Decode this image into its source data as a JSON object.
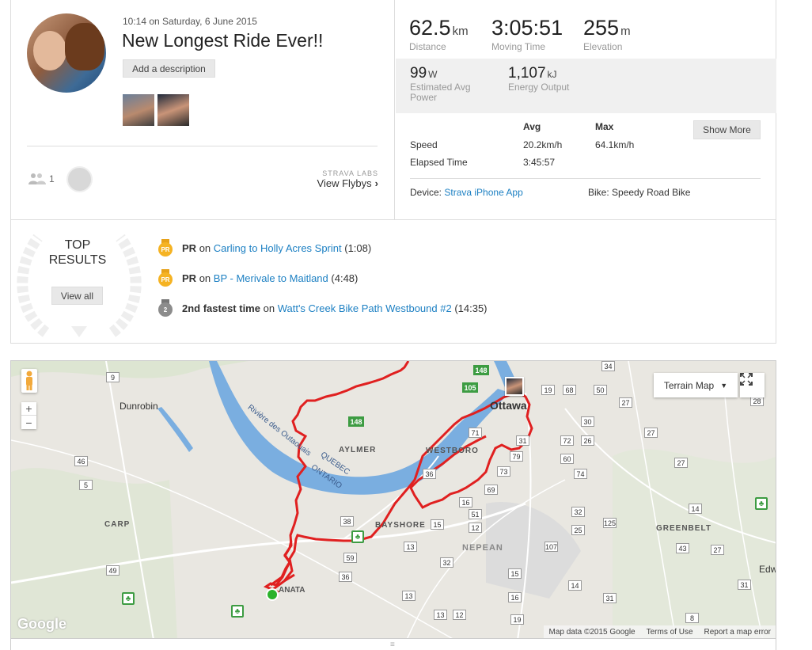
{
  "activity": {
    "timestamp": "10:14 on Saturday, 6 June 2015",
    "title": "New Longest Ride Ever!!",
    "add_description": "Add a description",
    "kudos_count": "1",
    "strava_labs": "STRAVA LABS",
    "view_flybys": "View Flybys"
  },
  "stats": {
    "distance": {
      "value": "62.5",
      "unit": "km",
      "label": "Distance"
    },
    "moving_time": {
      "value": "3:05:51",
      "label": "Moving Time"
    },
    "elevation": {
      "value": "255",
      "unit": "m",
      "label": "Elevation"
    },
    "power": {
      "value": "99",
      "unit": "W",
      "label": "Estimated Avg Power"
    },
    "energy": {
      "value": "1,107",
      "unit": "kJ",
      "label": "Energy Output"
    },
    "table": {
      "col_avg": "Avg",
      "col_max": "Max",
      "speed_label": "Speed",
      "speed_avg": "20.2km/h",
      "speed_max": "64.1km/h",
      "elapsed_label": "Elapsed Time",
      "elapsed_avg": "3:45:57"
    },
    "show_more": "Show More",
    "device_label": "Device:",
    "device_value": "Strava iPhone App",
    "bike_label": "Bike:",
    "bike_value": "Speedy Road Bike"
  },
  "results": {
    "title_line1": "TOP",
    "title_line2": "RESULTS",
    "view_all": "View all",
    "items": [
      {
        "badge": "PR",
        "medal": "gold",
        "prefix": "PR",
        "on": "on",
        "segment": "Carling to Holly Acres Sprint",
        "time": "(1:08)"
      },
      {
        "badge": "PR",
        "medal": "gold",
        "prefix": "PR",
        "on": "on",
        "segment": "BP - Merivale to Maitland",
        "time": "(4:48)"
      },
      {
        "badge": "2",
        "medal": "silver",
        "prefix": "2nd fastest time",
        "on": "on",
        "segment": "Watt's Creek Bike Path Westbound #2",
        "time": "(14:35)"
      }
    ]
  },
  "map": {
    "type_label": "Terrain Map",
    "zoom_in": "+",
    "zoom_out": "−",
    "google": "Google",
    "map_data": "Map data ©2015 Google",
    "terms": "Terms of Use",
    "report": "Report a map error",
    "places": {
      "ottawa": "Ottawa",
      "dunrobin": "Dunrobin",
      "aylmer": "AYLMER",
      "westboro": "WESTBORO",
      "bayshore": "BAYSHORE",
      "nepean": "NEPEAN",
      "carp": "CARP",
      "greenbelt": "GREENBELT",
      "kanata": "ANATA",
      "edw": "Edw",
      "quebec": "QUEBEC",
      "ontario": "ONTARIO",
      "river": "Rivière des Outaouais"
    },
    "route_color": "#e02020",
    "water_color": "#7aaee0"
  },
  "colors": {
    "link": "#1d80c3",
    "gold": "#f5b323",
    "silver": "#8c8c8c"
  }
}
